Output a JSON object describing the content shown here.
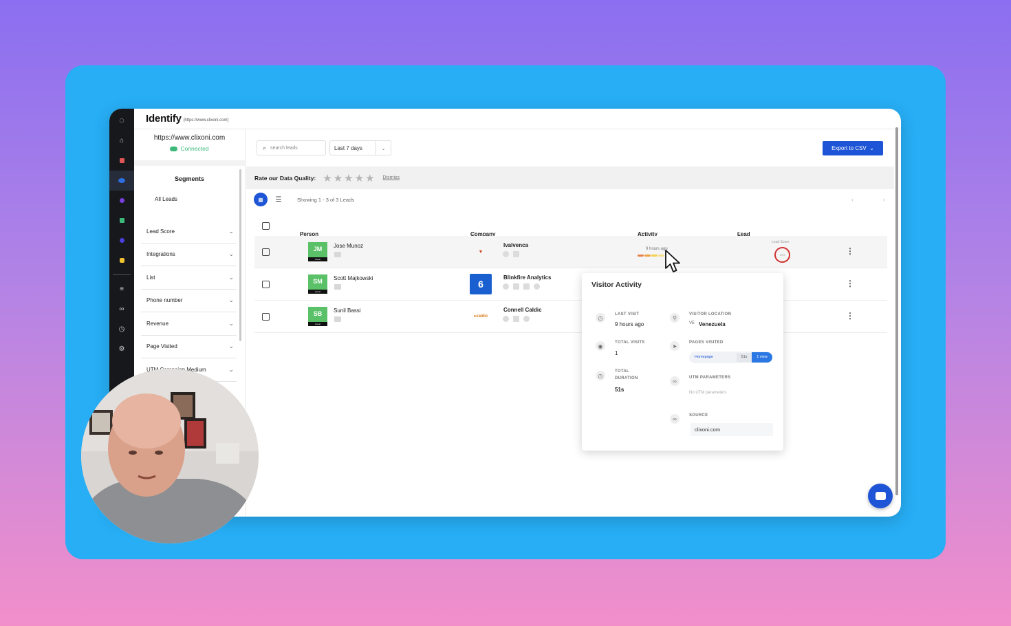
{
  "app": {
    "title": "Identify",
    "url_small": "[https://www.clixoni.com]"
  },
  "sidebar": {
    "site_url": "https://www.clixoni.com",
    "status": "Connected",
    "segments_title": "Segments",
    "all_leads": "All Leads",
    "filters": [
      "Lead Score",
      "Integrations",
      "List",
      "Phone number",
      "Revenue",
      "Page Visited",
      "UTM Campaign Medium"
    ]
  },
  "toolbar": {
    "search_placeholder": "search leads",
    "date_range": "Last 7 days",
    "export_label": "Export to CSV"
  },
  "rating": {
    "label": "Rate our Data Quality:",
    "dismiss": "Dismiss",
    "stars": "★★★★★"
  },
  "listing": {
    "showing": "Showing 1 - 3 of 3 Leads",
    "pager": "‹ ›"
  },
  "table": {
    "headers": {
      "person": "Person",
      "company": "Company",
      "activity": "Activity",
      "lead_score": "Lead Score"
    },
    "rows": [
      {
        "initials": "JM",
        "tag": "Guest",
        "name": "Jose Munoz",
        "company": "Ivalvenca",
        "logo": "▼",
        "activity_time": "9 hours ago",
        "lead_score_label": "Lead Score",
        "lead_score": "19%"
      },
      {
        "initials": "SM",
        "tag": "Guest",
        "name": "Scott Majkowski",
        "company": "Blinkfire Analytics",
        "logo": "6"
      },
      {
        "initials": "SB",
        "tag": "Guest",
        "name": "Sunil Bassi",
        "company": "Connell Caldic",
        "logo": "●caldic"
      }
    ]
  },
  "visitor_activity": {
    "title": "Visitor Activity",
    "last_visit_label": "LAST VISIT",
    "last_visit": "9 hours ago",
    "total_visits_label": "TOTAL VISITS",
    "total_visits": "1",
    "total_duration_label": "TOTAL DURATION",
    "total_duration": "51s",
    "location_label": "VISITOR LOCATION",
    "location_code": "VE",
    "location": "Venezuela",
    "pages_label": "PAGES VISITED",
    "page_name": "Homepage",
    "page_time": "51s",
    "page_views": "1 view",
    "utm_label": "UTM PARAMETERS",
    "utm_value": "No UTM parameters",
    "source_label": "SOURCE",
    "source": "clixoni.com"
  },
  "colors": {
    "accent": "#1e55d6",
    "frame": "#27aef5",
    "connected": "#3cb878",
    "avatar": "#5ac168",
    "score_ring": "#d32f2f"
  }
}
